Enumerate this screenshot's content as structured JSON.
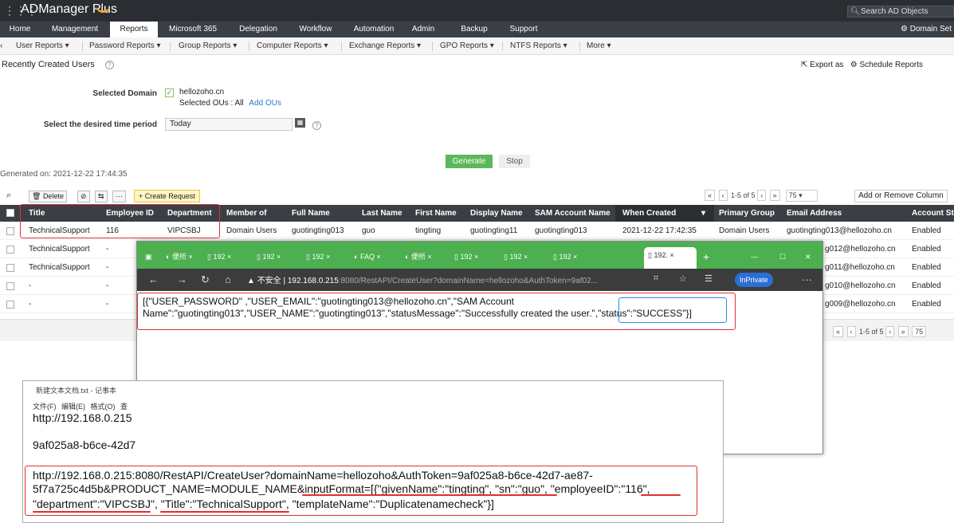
{
  "header": {
    "app_title": "ADManager Plus",
    "search_placeholder": "Search AD Objects",
    "domain_settings": "Domain Set"
  },
  "tabs": [
    {
      "label": "Home"
    },
    {
      "label": "Management"
    },
    {
      "label": "Reports"
    },
    {
      "label": "Microsoft 365"
    },
    {
      "label": "Delegation"
    },
    {
      "label": "Workflow"
    },
    {
      "label": "Automation"
    },
    {
      "label": "Admin"
    },
    {
      "label": "Backup"
    },
    {
      "label": "Support"
    }
  ],
  "submenu": [
    {
      "label": "User Reports"
    },
    {
      "label": "Password Reports"
    },
    {
      "label": "Group Reports"
    },
    {
      "label": "Computer Reports"
    },
    {
      "label": "Exchange Reports"
    },
    {
      "label": "GPO Reports"
    },
    {
      "label": "NTFS Reports"
    },
    {
      "label": "More"
    }
  ],
  "page": {
    "title": "Recently Created Users",
    "export_as": "Export as",
    "schedule_reports": "Schedule Reports"
  },
  "form": {
    "selected_domain_label": "Selected Domain",
    "domain_value": "hellozoho.cn",
    "selected_ous_label": "Selected OUs :",
    "selected_ous_value": "All",
    "add_ous": "Add OUs",
    "time_period_label": "Select the desired time period",
    "time_period_value": "Today",
    "generate": "Generate",
    "stop": "Stop",
    "generated_on": "Generated on: 2021-12-22 17:44:35"
  },
  "toolbar": {
    "delete": "Delete",
    "more": "···",
    "create_request": "Create Request",
    "range": "1-5 of 5",
    "page_size": "75",
    "add_remove_column": "Add or Remove Column"
  },
  "table": {
    "columns": [
      "Title",
      "Employee ID",
      "Department",
      "Member of",
      "Full Name",
      "Last Name",
      "First Name",
      "Display Name",
      "SAM Account Name",
      "When Created",
      "Primary Group",
      "Email Address",
      "Account Sta"
    ],
    "rows": [
      [
        "TechnicalSupport",
        "116",
        "VIPCSBJ",
        "Domain Users",
        "guotingting013",
        "guo",
        "tingting",
        "guotingting11",
        "guotingting013",
        "2021-12-22 17:42:35",
        "Domain Users",
        "guotingting013@hellozoho.cn",
        "Enabled"
      ],
      [
        "TechnicalSupport",
        "-",
        "",
        "",
        "",
        "",
        "",
        "",
        "",
        "",
        "",
        "g012@hellozoho.cn",
        "Enabled"
      ],
      [
        "TechnicalSupport",
        "-",
        "",
        "",
        "",
        "",
        "",
        "",
        "",
        "",
        "",
        "g011@hellozoho.cn",
        "Enabled"
      ],
      [
        "-",
        "-",
        "",
        "",
        "",
        "",
        "",
        "",
        "",
        "",
        "",
        "g010@hellozoho.cn",
        "Enabled"
      ],
      [
        "-",
        "-",
        "",
        "",
        "",
        "",
        "",
        "",
        "",
        "",
        "",
        "g009@hellozoho.cn",
        "Enabled"
      ]
    ],
    "footer_range": "1-5 of 5",
    "footer_page_size": "75"
  },
  "browser": {
    "tabs": [
      {
        "label": "便所"
      },
      {
        "label": "192"
      },
      {
        "label": "192"
      },
      {
        "label": "192"
      },
      {
        "label": "FAQ"
      },
      {
        "label": "便所"
      },
      {
        "label": "192"
      },
      {
        "label": "192"
      },
      {
        "label": "192"
      },
      {
        "label": "192."
      }
    ],
    "insecure": "不安全",
    "url_host": "192.168.0.215",
    "url_rest": ":8080/RestAPI/CreateUser?domainName=hellozoho&AuthToken=9af02...",
    "inprivate": "InPrivate",
    "response_line1": "[{\"USER_PASSWORD\"       ,\"USER_EMAIL\":\"guotingting013@hellozoho.cn\",\"SAM Account",
    "response_line2a": "Name\":\"guotingting013\",\"USER_NAME\":\"guotingting013\",\"statusMessage\":\"Successfully created the user.\"",
    "response_line2b": ",\"status\":\"SUCCESS\"}]"
  },
  "notepad": {
    "title": "新建文本文档.txt - 记事本",
    "menu": "文件(F) 编辑(E) 格式(O) 查",
    "line1": "http://192.168.0.215",
    "line2": "9af025a8-b6ce-42d7",
    "line3": "http://192.168.0.215:8080/RestAPI/CreateUser?domainName=hellozoho&AuthToken=9af025a8-b6ce-42d7-ae87-",
    "line4": "5f7a725c4d5b&PRODUCT_NAME=MODULE_NAME&inputFormat=[{\"givenName\":\"tingting\", \"sn\":\"guo\", \"employeeID\":\"116\",",
    "line5": "\"department\":\"VIPCSBJ\", \"Title\":\"TechnicalSupport\", \"templateName\":\"Duplicatenamecheck\"}]"
  }
}
